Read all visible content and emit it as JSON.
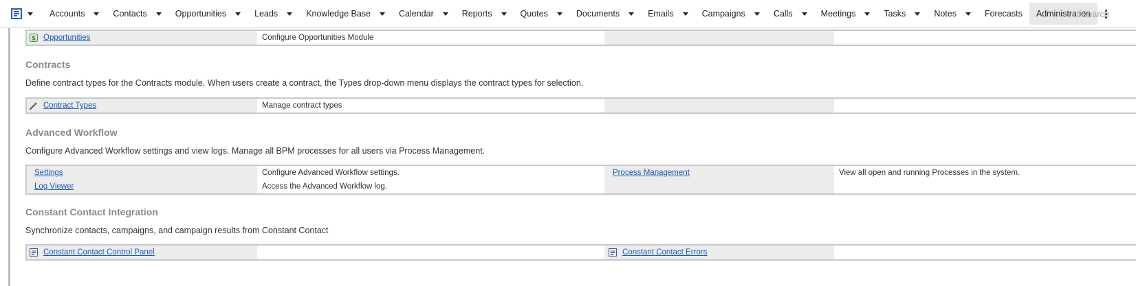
{
  "nav": {
    "items": [
      {
        "label": "Accounts",
        "dropdown": true
      },
      {
        "label": "Contacts",
        "dropdown": true
      },
      {
        "label": "Opportunities",
        "dropdown": true
      },
      {
        "label": "Leads",
        "dropdown": true
      },
      {
        "label": "Knowledge Base",
        "dropdown": true
      },
      {
        "label": "Calendar",
        "dropdown": true
      },
      {
        "label": "Reports",
        "dropdown": true
      },
      {
        "label": "Quotes",
        "dropdown": true
      },
      {
        "label": "Documents",
        "dropdown": true
      },
      {
        "label": "Emails",
        "dropdown": true
      },
      {
        "label": "Campaigns",
        "dropdown": true
      },
      {
        "label": "Calls",
        "dropdown": true
      },
      {
        "label": "Meetings",
        "dropdown": true
      },
      {
        "label": "Tasks",
        "dropdown": true
      },
      {
        "label": "Notes",
        "dropdown": true
      },
      {
        "label": "Forecasts",
        "dropdown": false
      },
      {
        "label": "Administration",
        "dropdown": false,
        "active": true
      }
    ],
    "search_placeholder": "Search"
  },
  "opportunities_row": {
    "link": "Opportunities",
    "description": "Configure Opportunities Module",
    "icon": "opportunities-icon"
  },
  "contracts": {
    "title": "Contracts",
    "description": "Define contract types for the Contracts module. When users create a contract, the Types drop-down menu displays the contract types for selection.",
    "rows": [
      {
        "link": "Contract Types",
        "description": "Manage contract types",
        "icon": "wrench-icon"
      }
    ]
  },
  "advanced_workflow": {
    "title": "Advanced Workflow",
    "description": "Configure Advanced Workflow settings and view logs. Manage all BPM processes for all users via Process Management.",
    "rows": [
      {
        "link": "Settings",
        "description": "Configure Advanced Workflow settings.",
        "link2": "Process Management",
        "description2": "View all open and running Processes in the system."
      },
      {
        "link": "Log Viewer",
        "description": "Access the Advanced Workflow log."
      }
    ]
  },
  "constant_contact": {
    "title": "Constant Contact Integration",
    "description": "Synchronize contacts, campaigns, and campaign results from Constant Contact",
    "rows": [
      {
        "link": "Constant Contact Control Panel",
        "link2": "Constant Contact Errors",
        "icon": "sugar-module-icon"
      }
    ]
  },
  "colors": {
    "link": "#1a5cb8",
    "section_title": "#8a8a8a",
    "cell_gray": "#ececec",
    "active_nav": "#e6e8ea"
  }
}
